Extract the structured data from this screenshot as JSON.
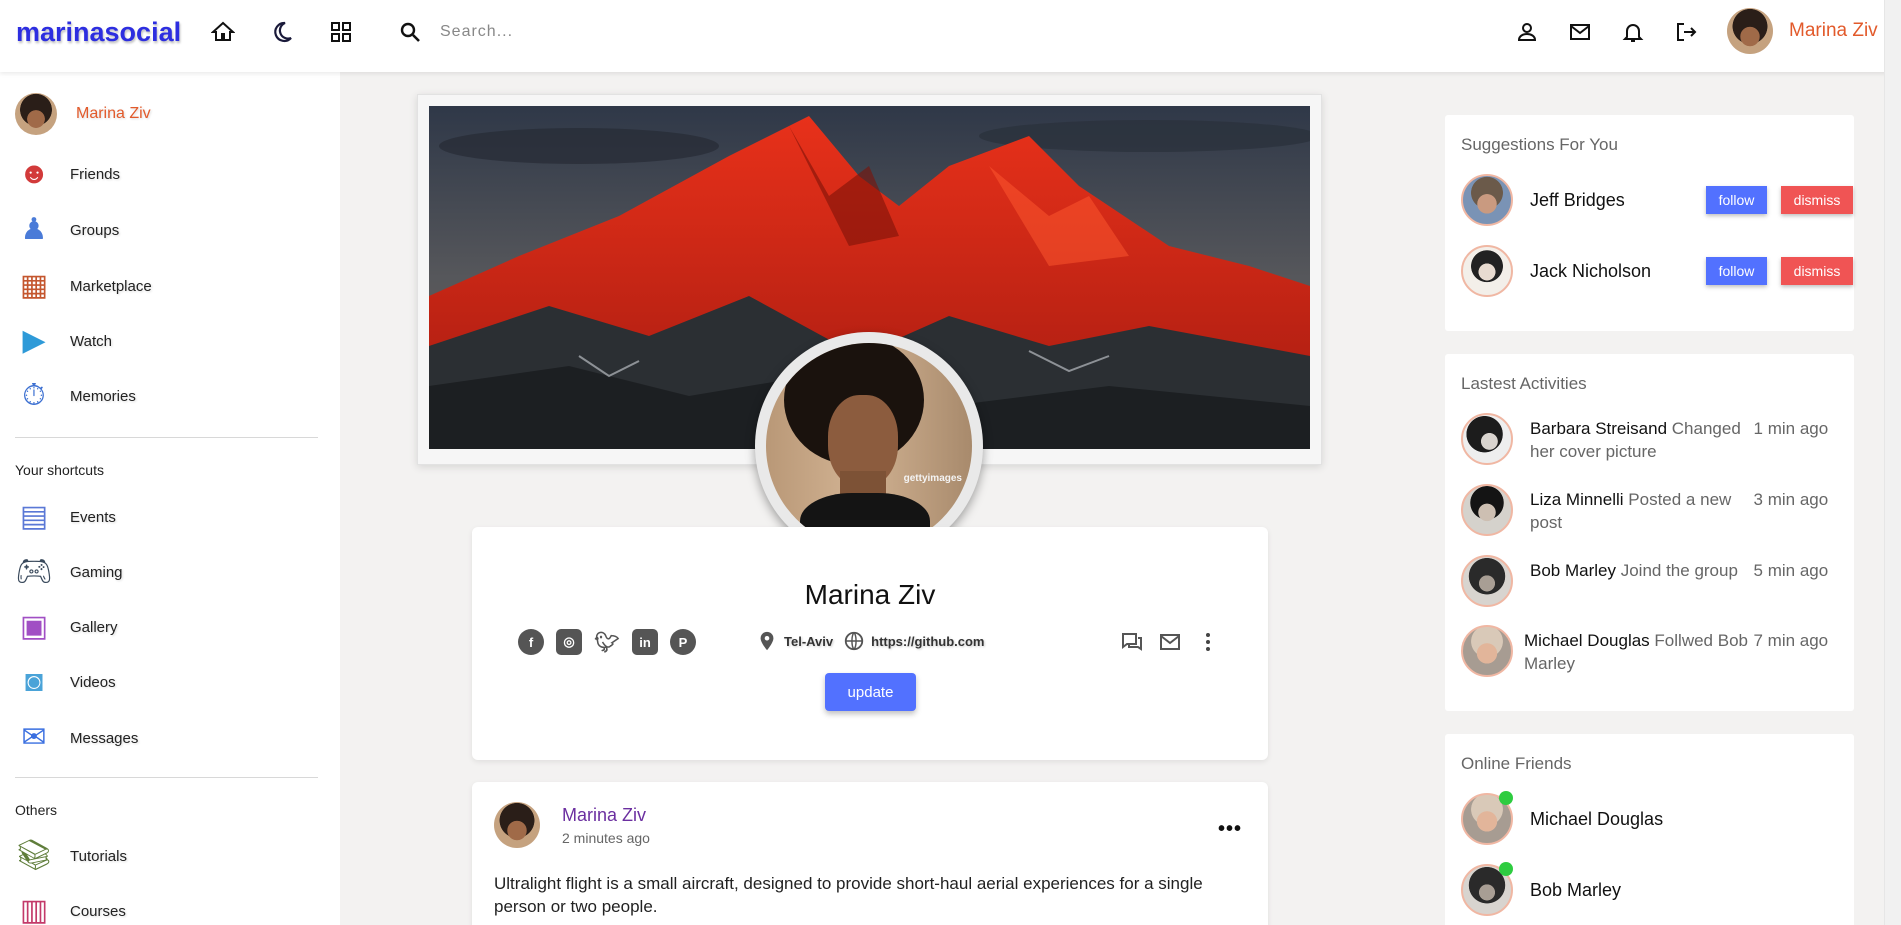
{
  "brand": {
    "logo": "marinasocial",
    "accent": "#2d2ee0",
    "user_color": "#e25a2b"
  },
  "navbar": {
    "icons": [
      "home-icon",
      "dark-mode-icon",
      "apps-grid-icon",
      "search-icon",
      "profile-icon",
      "mail-icon",
      "notifications-icon",
      "logout-icon"
    ],
    "search": {
      "placeholder": "Search...",
      "value": ""
    },
    "user_name": "Marina Ziv"
  },
  "sidebar": {
    "user_name": "Marina Ziv",
    "main_items": [
      {
        "label": "Friends",
        "icon": "friends-icon"
      },
      {
        "label": "Groups",
        "icon": "groups-icon"
      },
      {
        "label": "Marketplace",
        "icon": "marketplace-icon"
      },
      {
        "label": "Watch",
        "icon": "watch-icon"
      },
      {
        "label": "Memories",
        "icon": "memories-icon"
      }
    ],
    "shortcuts_heading": "Your shortcuts",
    "shortcuts": [
      {
        "label": "Events",
        "icon": "events-icon"
      },
      {
        "label": "Gaming",
        "icon": "gaming-icon"
      },
      {
        "label": "Gallery",
        "icon": "gallery-icon"
      },
      {
        "label": "Videos",
        "icon": "videos-icon"
      },
      {
        "label": "Messages",
        "icon": "messages-icon"
      }
    ],
    "others_heading": "Others",
    "others": [
      {
        "label": "Tutorials",
        "icon": "tutorials-icon"
      },
      {
        "label": "Courses",
        "icon": "courses-icon"
      }
    ]
  },
  "profile": {
    "watermark": "gettyimages",
    "name": "Marina Ziv",
    "location": "Tel-Aviv",
    "website": "https://github.com",
    "update_label": "update",
    "update_color": "#5271ff"
  },
  "post": {
    "author": "Marina Ziv",
    "time": "2 minutes ago",
    "menu": "•••",
    "text": "Ultralight flight is a small aircraft, designed to provide short-haul aerial experiences for a single person or two people."
  },
  "suggestions": {
    "title": "Suggestions For You",
    "follow_label": "follow",
    "dismiss_label": "dismiss",
    "items": [
      {
        "name": "Jeff Bridges"
      },
      {
        "name": "Jack Nicholson"
      }
    ]
  },
  "activities": {
    "title": "Lastest Activities",
    "items": [
      {
        "name": "Barbara Streisand",
        "action": "Changed her cover picture",
        "time": "1 min ago"
      },
      {
        "name": "Liza Minnelli",
        "action": "Posted a new post",
        "time": "3 min ago"
      },
      {
        "name": "Bob Marley",
        "action": "Joind the group",
        "time": "5 min ago"
      },
      {
        "name": "Michael Douglas",
        "action": "Follwed Bob Marley",
        "time": "7 min ago"
      }
    ]
  },
  "online": {
    "title": "Online Friends",
    "status_color": "#2ecc40",
    "items": [
      {
        "name": "Michael Douglas"
      },
      {
        "name": "Bob Marley"
      }
    ]
  }
}
